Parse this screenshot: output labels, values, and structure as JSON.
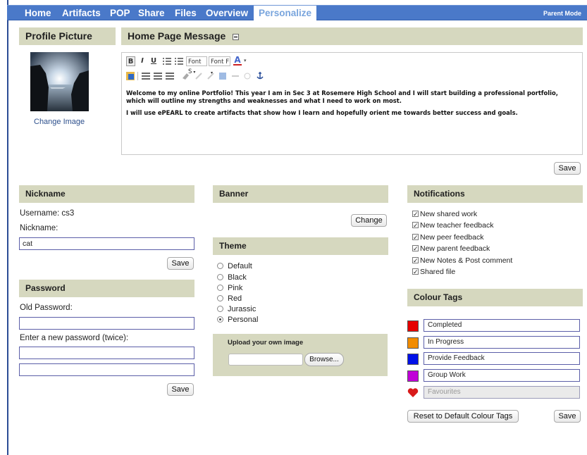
{
  "nav": {
    "tabs": [
      {
        "label": "Home"
      },
      {
        "label": "Artifacts"
      },
      {
        "label": "POP"
      },
      {
        "label": "Share"
      },
      {
        "label": "Files"
      },
      {
        "label": "Overview"
      },
      {
        "label": "Personalize"
      }
    ],
    "active_tab": "Personalize",
    "mode": "Parent Mode"
  },
  "profile": {
    "title": "Profile Picture",
    "change_image": "Change Image"
  },
  "homepage": {
    "title": "Home Page Message",
    "toolbar": {
      "font_size": "Font S",
      "font_family": "Font F",
      "bold": "B",
      "italic": "I",
      "underline": "U",
      "text_color": "A"
    },
    "message_p1": "Welcome to my online Portfolio! This year I am in Sec 3 at Rosemere High School and I will start building a professional portfolio, which will outline my strengths and weaknesses and what I need to work on most.",
    "message_p2": "I will use ePEARL to create artifacts that show how I learn and hopefully orient me towards better success and goals.",
    "save": "Save"
  },
  "nickname": {
    "title": "Nickname",
    "username_label": "Username: cs3",
    "nickname_label": "Nickname:",
    "nickname_value": "cat",
    "save": "Save"
  },
  "password": {
    "title": "Password",
    "old_label": "Old Password:",
    "new_label": "Enter a new password (twice):",
    "save": "Save"
  },
  "banner": {
    "title": "Banner",
    "change": "Change"
  },
  "theme": {
    "title": "Theme",
    "options": [
      "Default",
      "Black",
      "Pink",
      "Red",
      "Jurassic",
      "Personal"
    ],
    "selected": "Personal",
    "upload_label": "Upload your own image",
    "browse": "Browse..."
  },
  "notifications": {
    "title": "Notifications",
    "items": [
      {
        "label": "New shared work",
        "checked": true
      },
      {
        "label": "New teacher feedback",
        "checked": true
      },
      {
        "label": "New peer feedback",
        "checked": true
      },
      {
        "label": "New parent feedback",
        "checked": true
      },
      {
        "label": "New Notes & Post comment",
        "checked": true
      },
      {
        "label": "Shared file",
        "checked": true
      }
    ]
  },
  "colour_tags": {
    "title": "Colour Tags",
    "tags": [
      {
        "label": "Completed",
        "color": "#e60000"
      },
      {
        "label": "In Progress",
        "color": "#f28c00"
      },
      {
        "label": "Provide Feedback",
        "color": "#0010e8"
      },
      {
        "label": "Group Work",
        "color": "#c000d8"
      },
      {
        "label": "Favourites",
        "color": "#d81a1a",
        "icon": "heart-icon"
      }
    ],
    "reset": "Reset to Default Colour Tags",
    "save": "Save"
  }
}
